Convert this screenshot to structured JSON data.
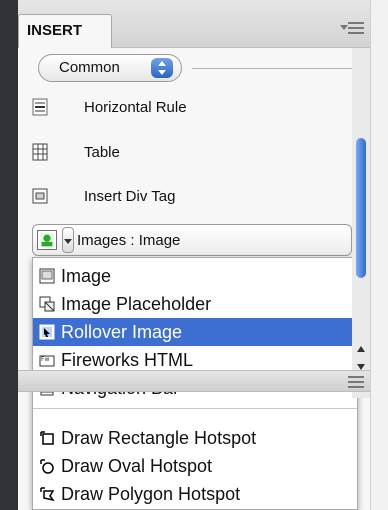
{
  "panel": {
    "tab_label": "INSERT",
    "category": "Common",
    "items": [
      {
        "label": "Horizontal Rule",
        "icon": "horizontal-rule-icon"
      },
      {
        "label": "Table",
        "icon": "table-icon"
      },
      {
        "label": "Insert Div Tag",
        "icon": "div-tag-icon"
      }
    ],
    "images_button_label": "Images : Image"
  },
  "dropdown": {
    "items": [
      {
        "label": "Image",
        "icon": "image-icon",
        "selected": false
      },
      {
        "label": "Image Placeholder",
        "icon": "image-placeholder-icon",
        "selected": false
      },
      {
        "label": "Rollover Image",
        "icon": "rollover-image-icon",
        "selected": true
      },
      {
        "label": "Fireworks HTML",
        "icon": "fireworks-html-icon",
        "selected": false
      },
      {
        "label": "Navigation Bar",
        "icon": "navigation-bar-icon",
        "selected": false
      },
      {
        "label": "Draw Rectangle Hotspot",
        "icon": "rectangle-hotspot-icon",
        "selected": false
      },
      {
        "label": "Draw Oval Hotspot",
        "icon": "oval-hotspot-icon",
        "selected": false
      },
      {
        "label": "Draw Polygon Hotspot",
        "icon": "polygon-hotspot-icon",
        "selected": false
      }
    ]
  },
  "colors": {
    "selection": "#3d6fd2",
    "scroll_thumb": "#2f6bd1",
    "panel_bg": "#f7f7f7"
  }
}
